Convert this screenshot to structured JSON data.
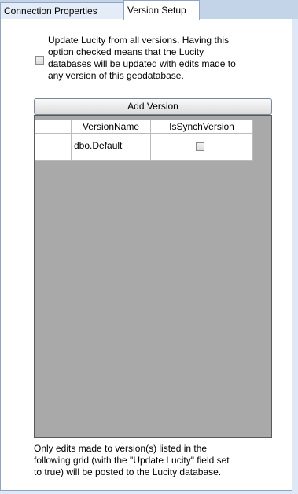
{
  "tabs": [
    {
      "label": "Connection Properties"
    },
    {
      "label": "Version Setup"
    }
  ],
  "update_option": {
    "checked": false,
    "description": "Update Lucity from all versions.  Having this\noption checked means that the Lucity\ndatabases will be updated with edits made to\nany version of this geodatabase."
  },
  "add_version_button": {
    "label": "Add Version"
  },
  "grid": {
    "columns": [
      "VersionName",
      "IsSynchVersion"
    ],
    "rows": [
      {
        "VersionName": "dbo.Default",
        "IsSynchVersion": false
      }
    ]
  },
  "footer_note": "Only edits made to version(s) listed in the\nfollowing grid (with the \"Update Lucity\" field set\nto true) will be posted to the Lucity database."
}
